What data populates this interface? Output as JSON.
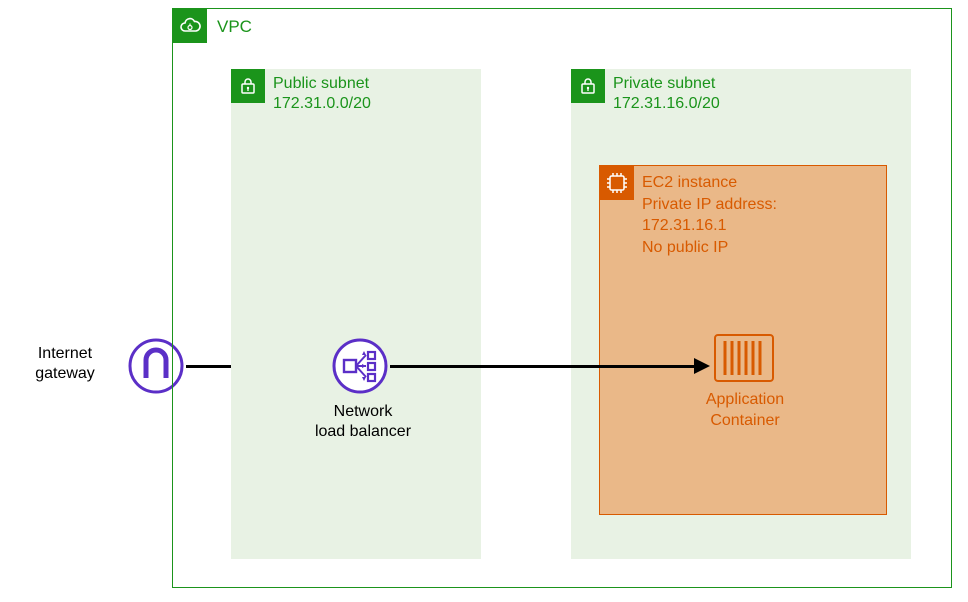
{
  "igw": {
    "label": "Internet\ngateway"
  },
  "vpc": {
    "label": "VPC"
  },
  "public_subnet": {
    "title": "Public subnet",
    "cidr": "172.31.0.0/20"
  },
  "private_subnet": {
    "title": "Private subnet",
    "cidr": "172.31.16.0/20"
  },
  "nlb": {
    "label": "Network\nload balancer"
  },
  "ec2": {
    "title": "EC2 instance",
    "line2": "Private IP address:",
    "ip": "172.31.16.1",
    "nopub": "No public IP"
  },
  "container": {
    "label": "Application\nContainer"
  },
  "colors": {
    "green": "#1b941b",
    "orange": "#d85a00",
    "purple": "#5b2fc7"
  }
}
